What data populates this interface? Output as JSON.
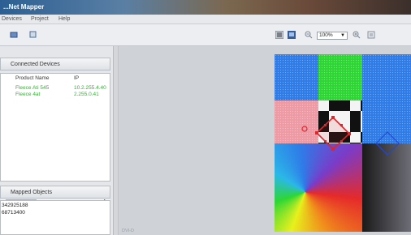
{
  "window": {
    "title": "...Net Mapper"
  },
  "menu": {
    "items": [
      "Devices",
      "Project",
      "Help"
    ]
  },
  "toolbar": {
    "zoom_value": "100%",
    "zoom_arrow": "▼"
  },
  "sidebar": {
    "connected_devices": {
      "title": "Connected Devices",
      "columns": [
        "Product Name",
        "IP"
      ],
      "rows": [
        {
          "name": "Fleece Ati 545",
          "ip": "10.2.255.4.40"
        },
        {
          "name": "Fleece 4at",
          "ip": "2.255.0.41"
        }
      ],
      "scroll_arrow": "▸"
    },
    "mapped_objects": {
      "title": "Mapped Objects",
      "items": [
        "342925188",
        "68713400"
      ]
    }
  },
  "workspace": {
    "label": "DVI-D"
  },
  "colors": {
    "blue": "#2f7be8",
    "green": "#2ed634",
    "pink": "#ee9aa5",
    "selection": "#e0242a",
    "handle": "#2147d6"
  }
}
